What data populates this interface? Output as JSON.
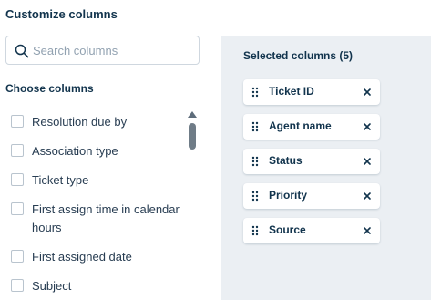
{
  "header": {
    "title": "Customize columns"
  },
  "search": {
    "placeholder": "Search columns",
    "value": ""
  },
  "available": {
    "label": "Choose columns",
    "items": [
      {
        "label": "Resolution due by",
        "checked": false
      },
      {
        "label": "Association type",
        "checked": false
      },
      {
        "label": "Ticket type",
        "checked": false
      },
      {
        "label": "First assign time in calendar hours",
        "checked": false
      },
      {
        "label": "First assigned date",
        "checked": false
      },
      {
        "label": "Subject",
        "checked": false
      }
    ]
  },
  "selected": {
    "title": "Selected columns (5)",
    "items": [
      {
        "label": "Ticket ID"
      },
      {
        "label": "Agent name"
      },
      {
        "label": "Status"
      },
      {
        "label": "Priority"
      },
      {
        "label": "Source"
      }
    ]
  },
  "icons": {
    "search": "search-icon",
    "drag": "drag-handle-icon",
    "remove": "close-icon",
    "scroll_up": "scroll-up-arrow-icon"
  }
}
